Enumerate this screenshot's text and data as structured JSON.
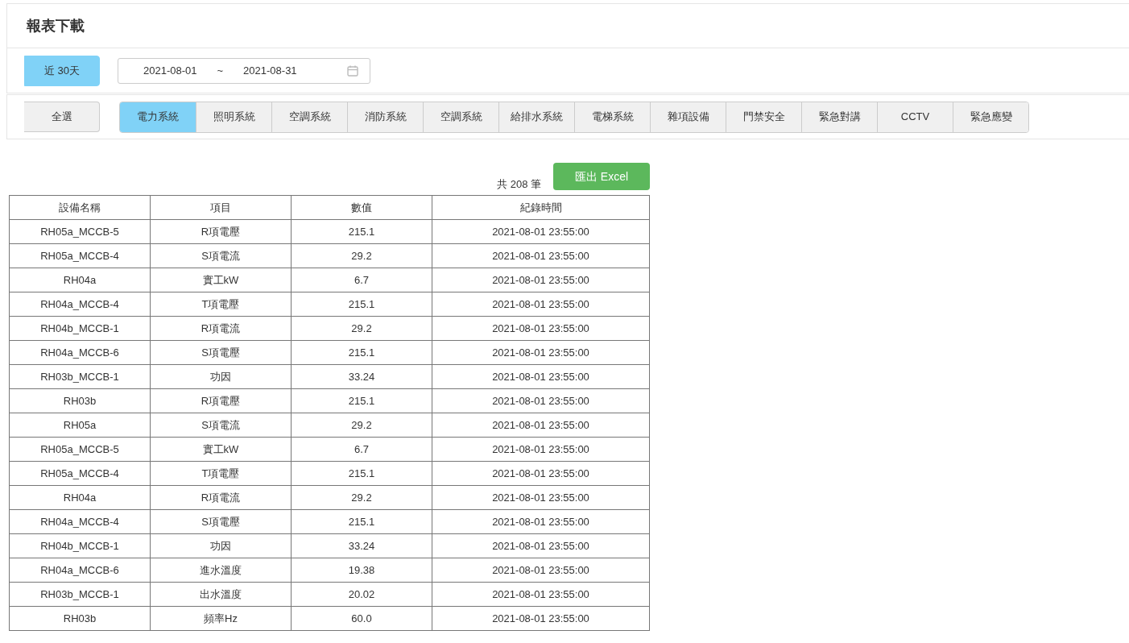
{
  "page": {
    "title": "報表下載"
  },
  "range_buttons": [
    {
      "label": "近 30天",
      "selected": true
    }
  ],
  "date_range": {
    "start": "2021-08-01",
    "separator": "~",
    "end": "2021-08-31"
  },
  "select_all": {
    "label": "全選"
  },
  "system_tabs": [
    {
      "label": "電力系統",
      "selected": true
    },
    {
      "label": "照明系統",
      "selected": false
    },
    {
      "label": "空調系統",
      "selected": false
    },
    {
      "label": "消防系統",
      "selected": false
    },
    {
      "label": "空調系統",
      "selected": false
    },
    {
      "label": "給排水系統",
      "selected": false
    },
    {
      "label": "電梯系統",
      "selected": false
    },
    {
      "label": "雜項設備",
      "selected": false
    },
    {
      "label": "門禁安全",
      "selected": false
    },
    {
      "label": "緊急對講",
      "selected": false
    },
    {
      "label": "CCTV",
      "selected": false
    },
    {
      "label": "緊急應變",
      "selected": false
    }
  ],
  "record_count": "共 208 筆",
  "export_button": "匯出 Excel",
  "table": {
    "columns": [
      "設備名稱",
      "項目",
      "數值",
      "紀錄時間"
    ],
    "rows": [
      [
        "RH05a_MCCB-5",
        "R項電壓",
        "215.1",
        "2021-08-01 23:55:00"
      ],
      [
        "RH05a_MCCB-4",
        "S項電流",
        "29.2",
        "2021-08-01 23:55:00"
      ],
      [
        "RH04a",
        "實工kW",
        "6.7",
        "2021-08-01 23:55:00"
      ],
      [
        "RH04a_MCCB-4",
        "T項電壓",
        "215.1",
        "2021-08-01 23:55:00"
      ],
      [
        "RH04b_MCCB-1",
        "R項電流",
        "29.2",
        "2021-08-01 23:55:00"
      ],
      [
        "RH04a_MCCB-6",
        "S項電壓",
        "215.1",
        "2021-08-01 23:55:00"
      ],
      [
        "RH03b_MCCB-1",
        "功因",
        "33.24",
        "2021-08-01 23:55:00"
      ],
      [
        "RH03b",
        "R項電壓",
        "215.1",
        "2021-08-01 23:55:00"
      ],
      [
        "RH05a",
        "S項電流",
        "29.2",
        "2021-08-01 23:55:00"
      ],
      [
        "RH05a_MCCB-5",
        "實工kW",
        "6.7",
        "2021-08-01 23:55:00"
      ],
      [
        "RH05a_MCCB-4",
        "T項電壓",
        "215.1",
        "2021-08-01 23:55:00"
      ],
      [
        "RH04a",
        "R項電流",
        "29.2",
        "2021-08-01 23:55:00"
      ],
      [
        "RH04a_MCCB-4",
        "S項電壓",
        "215.1",
        "2021-08-01 23:55:00"
      ],
      [
        "RH04b_MCCB-1",
        "功因",
        "33.24",
        "2021-08-01 23:55:00"
      ],
      [
        "RH04a_MCCB-6",
        "進水溫度",
        "19.38",
        "2021-08-01 23:55:00"
      ],
      [
        "RH03b_MCCB-1",
        "出水溫度",
        "20.02",
        "2021-08-01 23:55:00"
      ],
      [
        "RH03b",
        "頻率Hz",
        "60.0",
        "2021-08-01 23:55:00"
      ]
    ]
  }
}
